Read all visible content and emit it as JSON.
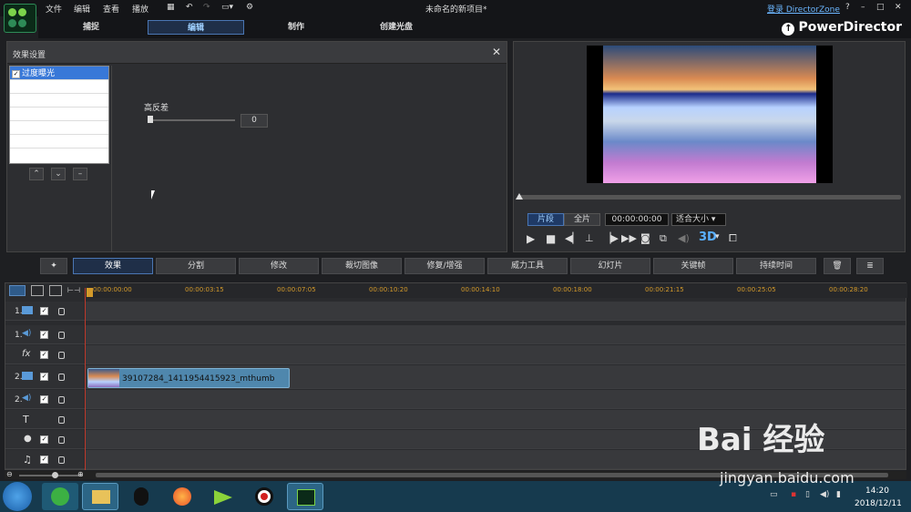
{
  "titlebar": {
    "title": "未命名的新项目*",
    "login": "登录 DirectorZone",
    "help": "?",
    "min": "–",
    "max": "□",
    "close": "✕",
    "menus": [
      "文件",
      "编辑",
      "查看",
      "播放"
    ]
  },
  "modes": [
    "捕捉",
    "编辑",
    "制作",
    "创建光盘"
  ],
  "brand": "PowerDirector",
  "effect_panel": {
    "title": "效果设置",
    "close": "✕",
    "list": [
      "过度曝光"
    ],
    "param_label": "高反差",
    "param_value": "0"
  },
  "preview": {
    "tab_clip": "片段",
    "tab_full": "全片",
    "timecode": "00:00:00:00",
    "fit": "适合大小",
    "mode3d": "3D"
  },
  "fx_buttons": [
    "效果",
    "分割",
    "修改",
    "裁切图像",
    "修复/增强",
    "威力工具",
    "幻灯片",
    "关键帧",
    "持续时间"
  ],
  "timeline": {
    "ticks": [
      "00:00:00:00",
      "00:00:03:15",
      "00:00:07:05",
      "00:00:10:20",
      "00:00:14:10",
      "00:00:18:00",
      "00:00:21:15",
      "00:00:25:05",
      "00:00:28:20"
    ],
    "tracks": [
      "1.",
      "1.",
      "fx",
      "2.",
      "2.",
      "T",
      "mic",
      "music"
    ],
    "clip_label": "39107284_1411954415923_mthumb"
  },
  "taskbar": {
    "time": "14:20",
    "date": "2018/12/11"
  },
  "watermark": {
    "text": "Bai 经验",
    "url": "jingyan.baidu.com"
  }
}
